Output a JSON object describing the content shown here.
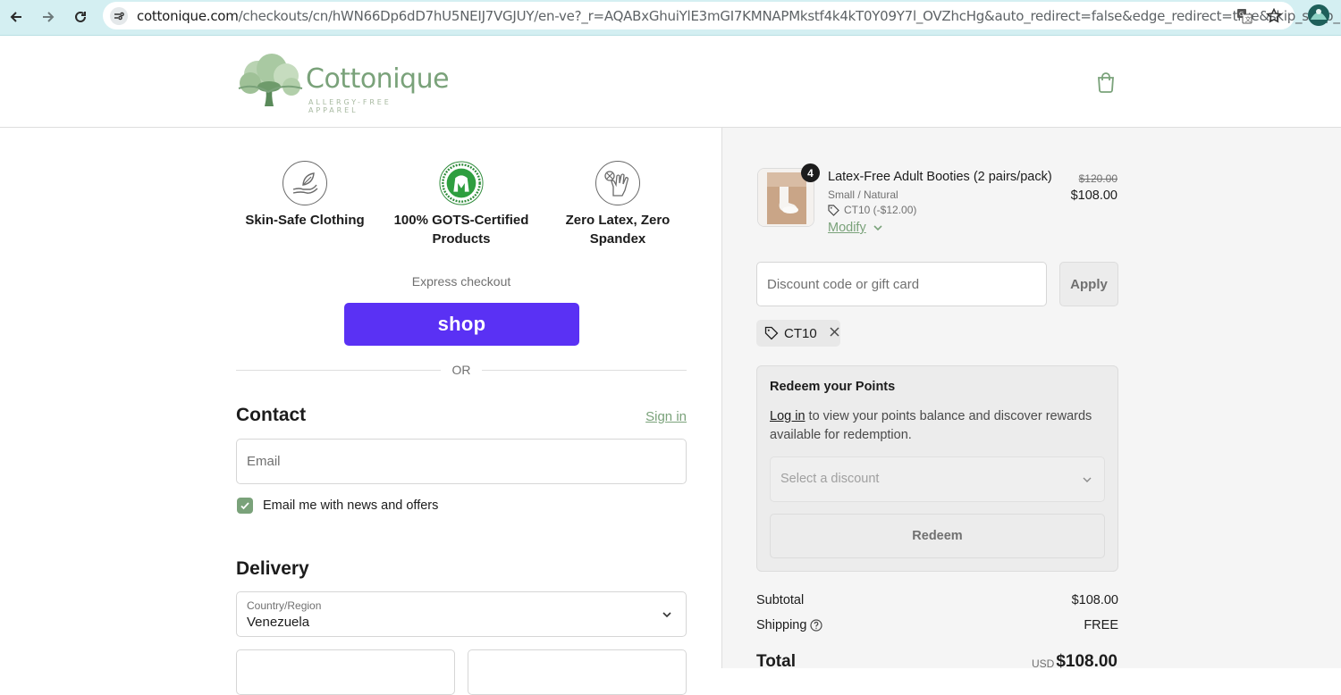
{
  "browser": {
    "url_host": "cottonique.com",
    "url_path": "/checkouts/cn/hWN66Dp6dD7hU5NEIJ7VGJUY/en-ve?_r=AQABxGhuiYlE3mGI7KMNAPMkstf4k4kT0Y09Y7l_OVZhcHg&auto_redirect=false&edge_redirect=true&skip_shop_pay=true",
    "icons": [
      "back-icon",
      "forward-icon",
      "reload-icon",
      "site-info-icon",
      "translate-icon",
      "bookmark-star-icon",
      "profile-avatar"
    ]
  },
  "header": {
    "logo_word": "Cottonique",
    "logo_tagline": "ALLERGY-FREE APPAREL",
    "cart_icon": "shopping-bag-icon"
  },
  "badges": [
    {
      "label": "Skin-Safe Clothing",
      "icon": "hand-leaf-icon"
    },
    {
      "label": "100% GOTS-Certified Products",
      "icon": "gots-logo-icon"
    },
    {
      "label": "Zero Latex, Zero Spandex",
      "icon": "no-latex-glove-icon"
    }
  ],
  "express": {
    "label": "Express checkout",
    "shop_label": "shop",
    "or_label": "OR"
  },
  "contact": {
    "title": "Contact",
    "signin_label": "Sign in",
    "email_placeholder": "Email",
    "newsletter_label": "Email me with news and offers",
    "newsletter_checked": true
  },
  "delivery": {
    "title": "Delivery",
    "country_label": "Country/Region",
    "country_value": "Venezuela"
  },
  "order": {
    "item": {
      "quantity": "4",
      "title": "Latex-Free Adult Booties (2 pairs/pack)",
      "variant": "Small / Natural",
      "discount": "CT10 (-$12.00)",
      "modify_label": "Modify",
      "original_price": "$120.00",
      "price": "$108.00"
    },
    "discount_placeholder": "Discount code or gift card",
    "apply_label": "Apply",
    "applied_code": "CT10",
    "points": {
      "title": "Redeem your Points",
      "login_label": "Log in",
      "text": " to view your points balance and discover rewards available for redemption.",
      "select_placeholder": "Select a discount",
      "redeem_label": "Redeem"
    },
    "summary": {
      "subtotal_label": "Subtotal",
      "subtotal_value": "$108.00",
      "shipping_label": "Shipping",
      "shipping_value": "FREE",
      "total_label": "Total",
      "total_currency": "USD",
      "total_value": "$108.00"
    }
  },
  "colors": {
    "accent": "#7aa27a",
    "shop_pay": "#5a31f4",
    "chrome": "#d4eff2"
  }
}
